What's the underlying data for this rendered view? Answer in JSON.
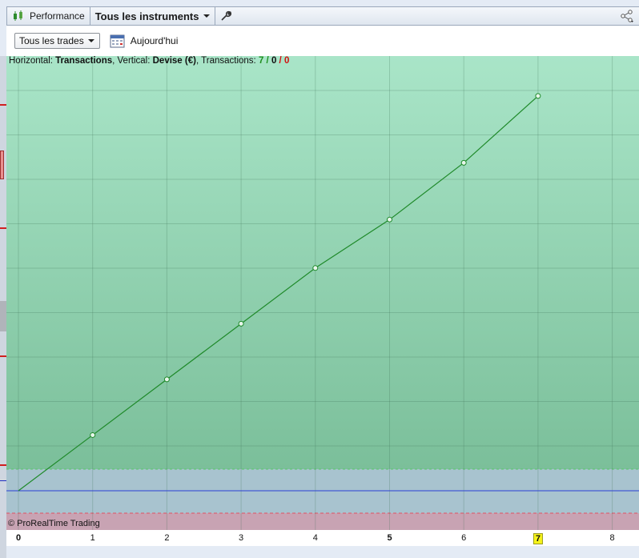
{
  "toolbar": {
    "performance_label": "Performance",
    "instruments_label": "Tous les instruments"
  },
  "subbar": {
    "filter_label": "Tous les trades",
    "today_label": "Aujourd'hui"
  },
  "header": {
    "horizontal_prefix": "Horizontal: ",
    "horizontal_value": "Transactions",
    "vertical_prefix": ", Vertical: ",
    "vertical_value": "Devise (€)",
    "transactions_prefix": ", Transactions: ",
    "count_total": "7",
    "count_mid": "0",
    "count_red": "0",
    "sep": " / "
  },
  "copyright": "© ProRealTime Trading",
  "colors": {
    "line": "#1f8a2a",
    "zero_line": "#2a3fd6",
    "loss_band": "#c8a3b3",
    "neutral_band": "#a8c3cf"
  },
  "chart_data": {
    "type": "line",
    "x": [
      0,
      1,
      2,
      3,
      4,
      5,
      6,
      7
    ],
    "y": [
      0,
      1,
      2,
      3,
      4,
      4.87,
      5.89,
      7.09
    ],
    "xlim": [
      0,
      8.2
    ],
    "xticks": [
      "0",
      "1",
      "2",
      "3",
      "4",
      "5",
      "6",
      "7",
      "8"
    ],
    "bold_ticks": [
      "0",
      "5"
    ],
    "highlight_tick": "7",
    "grid": true
  }
}
